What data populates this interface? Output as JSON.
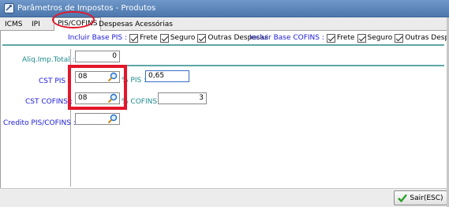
{
  "window": {
    "title": "Parâmetros de Impostos - Produtos"
  },
  "tabs": [
    {
      "label": "ICMS",
      "active": false
    },
    {
      "label": "IPI",
      "active": false
    },
    {
      "label": "PIS/COFINS",
      "active": true
    },
    {
      "label": "Despesas Acessórias",
      "active": false
    }
  ],
  "incluir_pis": {
    "label": "Incluir Base PIS :",
    "options": [
      {
        "label": "Frete",
        "checked": true
      },
      {
        "label": "Seguro",
        "checked": true
      },
      {
        "label": "Outras Despesas",
        "checked": true
      }
    ]
  },
  "incluir_cofins": {
    "label": "Incluir Base COFINS :",
    "options": [
      {
        "label": "Frete",
        "checked": true
      },
      {
        "label": "Seguro",
        "checked": true
      },
      {
        "label": "Outras Despesas",
        "checked": true
      }
    ]
  },
  "form": {
    "aliq_total_label": "Aliq.Imp.Total :",
    "aliq_total_value": "0",
    "cst_pis_label": "CST PIS :",
    "cst_pis_value": "08",
    "pis_pct_label": "% PIS :",
    "pis_pct_value": "0,65",
    "cst_cofins_label": "CST COFINS :",
    "cst_cofins_value": "08",
    "cofins_pct_label": "% COFINS :",
    "cofins_pct_value": "3",
    "credito_label": "Credito PIS/COFINS :",
    "credito_value": ""
  },
  "footer": {
    "sair_label": "Sair(ESC)"
  },
  "colors": {
    "label_blue": "#1a1ad6",
    "label_teal": "#1e8b8b",
    "highlight_red": "#e3162a",
    "title_bar": "#5a84b9"
  },
  "icons": {
    "search": "magnifier-icon",
    "exit": "check-icon",
    "app": "app-icon"
  }
}
